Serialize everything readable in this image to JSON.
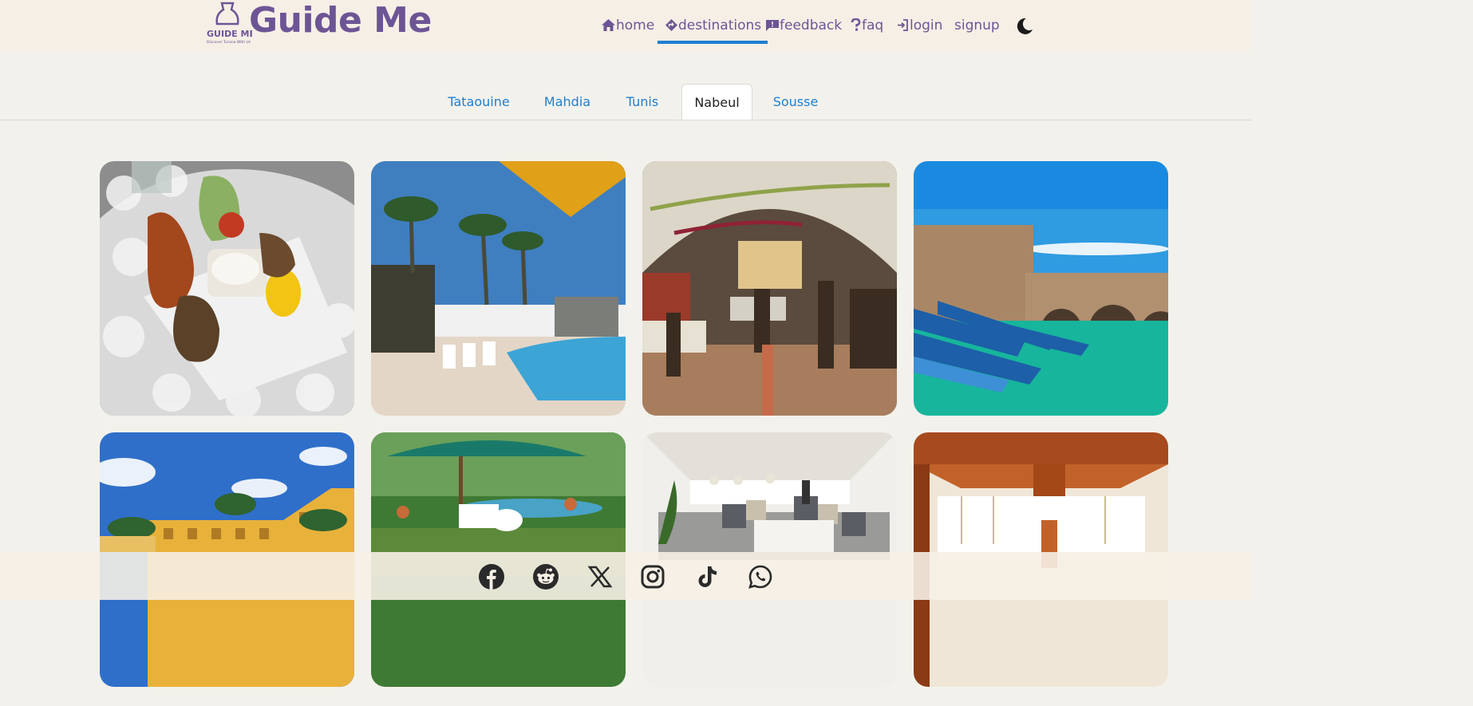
{
  "brand": {
    "name": "Guide Me",
    "logo_text": "GUIDE ME",
    "logo_subtext": "Discover Tunisia With Us"
  },
  "nav": {
    "items": [
      {
        "label": "home",
        "icon": "home-icon"
      },
      {
        "label": "destinations",
        "icon": "diamond-turn-icon"
      },
      {
        "label": "feedback",
        "icon": "message-icon"
      },
      {
        "label": "faq",
        "icon": "question-icon"
      },
      {
        "label": "login",
        "icon": "login-icon"
      },
      {
        "label": "signup",
        "icon": ""
      }
    ],
    "active": "destinations",
    "theme_icon": "moon-icon"
  },
  "tabs": {
    "items": [
      "Tataouine",
      "Mahdia",
      "Tunis",
      "Nabeul",
      "Sousse"
    ],
    "active": "Nabeul"
  },
  "gallery": {
    "photos": [
      "grilled-seafood-plate",
      "hotel-pool-palms",
      "vaulted-restaurant-interior",
      "harbor-fort-blue-boats",
      "yellow-hotel-palms",
      "garden-pool-umbrella",
      "white-lounge-cushions",
      "wooden-ceiling-hall"
    ]
  },
  "footer": {
    "social": [
      "facebook-icon",
      "reddit-icon",
      "x-icon",
      "instagram-icon",
      "tiktok-icon",
      "whatsapp-icon"
    ]
  },
  "colors": {
    "brand": "#6d5595",
    "accent": "#1e7fd1",
    "header_bg": "#f6efe6",
    "page_bg": "#f3f1ec"
  }
}
